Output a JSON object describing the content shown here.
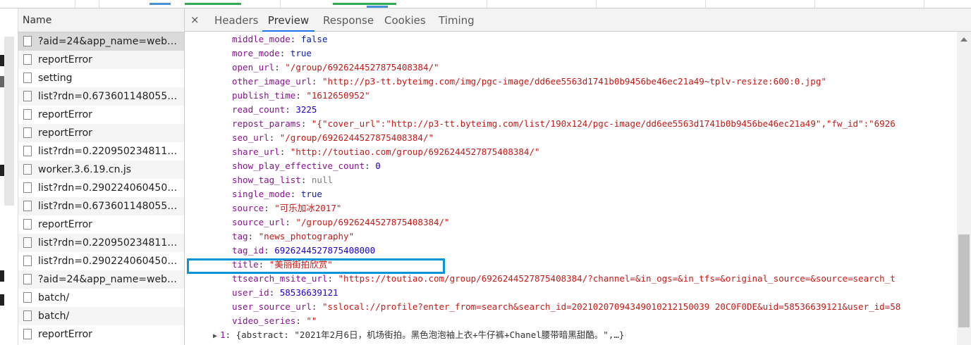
{
  "name_panel": {
    "header": "Name",
    "rows": [
      "?aid=24&app_name=web_s...",
      "reportError",
      "setting",
      "list?rdn=0.6736011480550843",
      "reportError",
      "reportError",
      "list?rdn=0.220950234811552...",
      "worker.3.6.19.cn.js",
      "list?rdn=0.2902240604501649",
      "list?rdn=0.6736011480550843",
      "reportError",
      "list?rdn=0.220950234811552...",
      "list?rdn=0.2902240604501649",
      "?aid=24&app_name=web_s...",
      "batch/",
      "batch/",
      "reportError"
    ]
  },
  "tabs": {
    "close": "×",
    "items": [
      "Headers",
      "Preview",
      "Response",
      "Cookies",
      "Timing"
    ],
    "active": "Preview"
  },
  "preview": {
    "lines": [
      {
        "key": "middle_mode",
        "value": "false",
        "type": "bool"
      },
      {
        "key": "more_mode",
        "value": "true",
        "type": "bool"
      },
      {
        "key": "open_url",
        "value": "\"/group/6926244527875408384/\"",
        "type": "str"
      },
      {
        "key": "other_image_url",
        "value": "\"http://p3-tt.byteimg.com/img/pgc-image/dd6ee5563d1741b0b9456be46ec21a49~tplv-resize:600:0.jpg\"",
        "type": "str"
      },
      {
        "key": "publish_time",
        "value": "\"1612650952\"",
        "type": "str"
      },
      {
        "key": "read_count",
        "value": "3225",
        "type": "num"
      },
      {
        "key": "repost_params",
        "value": "\"{\"cover_url\":\"http://p3-tt.byteimg.com/list/190x124/pgc-image/dd6ee5563d1741b0b9456be46ec21a49\",\"fw_id\":\"6926",
        "type": "str"
      },
      {
        "key": "seo_url",
        "value": "\"/group/6926244527875408384/\"",
        "type": "str"
      },
      {
        "key": "share_url",
        "value": "\"http://toutiao.com/group/6926244527875408384/\"",
        "type": "str"
      },
      {
        "key": "show_play_effective_count",
        "value": "0",
        "type": "num"
      },
      {
        "key": "show_tag_list",
        "value": "null",
        "type": "null"
      },
      {
        "key": "single_mode",
        "value": "true",
        "type": "bool"
      },
      {
        "key": "source",
        "value": "\"可乐加冰2017\"",
        "type": "str"
      },
      {
        "key": "source_url",
        "value": "\"/group/6926244527875408384/\"",
        "type": "str"
      },
      {
        "key": "tag",
        "value": "\"news_photography\"",
        "type": "str"
      },
      {
        "key": "tag_id",
        "value": "6926244527875408000",
        "type": "num"
      },
      {
        "key": "title",
        "value": "\"美丽街拍欣赏\"",
        "type": "str"
      },
      {
        "key": "ttsearch_msite_url",
        "value": "\"https://toutiao.com/group/6926244527875408384/?channel=&in_ogs=&in_tfs=&original_source=&source=search_t",
        "type": "str"
      },
      {
        "key": "user_id",
        "value": "58536639121",
        "type": "num"
      },
      {
        "key": "user_source_url",
        "value": "\"sslocal://profile?enter_from=search&search_id=20210207094349010212150039 20C0F0DE&uid=58536639121&user_id=58",
        "type": "str"
      },
      {
        "key": "video_series",
        "value": "\"\"",
        "type": "str"
      }
    ],
    "collapsed_item": {
      "index": "1",
      "text": "{abstract: \"2021年2月6日，机场街拍。黑色泡泡袖上衣+牛仔裤+Chanel腰带暗黑甜酷。\",…}"
    }
  },
  "colors": {
    "key": "#881391",
    "string": "#c41a16",
    "number": "#1c00cf",
    "highlight_border": "#0a95d8",
    "active_tab": "#1a73e8"
  },
  "icons": [
    "close-icon",
    "file-icon",
    "expand-triangle-icon",
    "scroll-up-icon"
  ]
}
